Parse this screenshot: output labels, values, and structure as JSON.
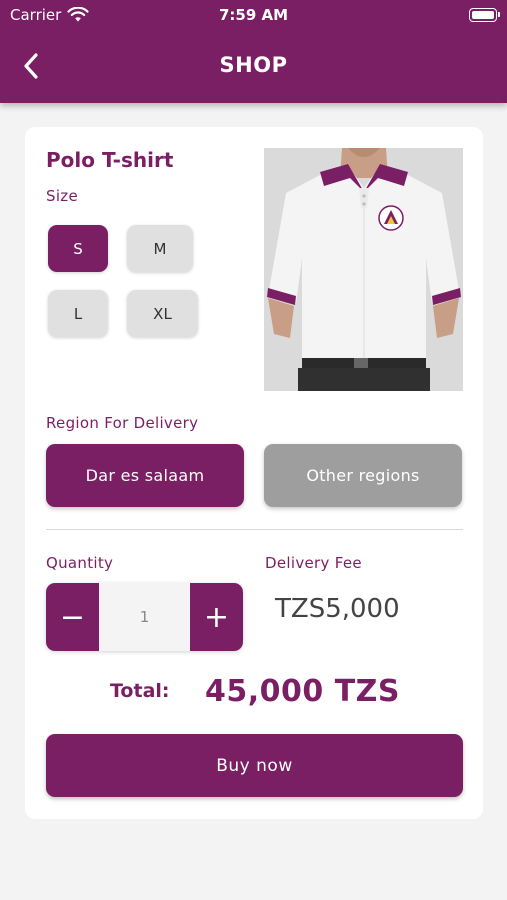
{
  "status_bar": {
    "carrier": "Carrier",
    "time": "7:59 AM"
  },
  "header": {
    "title": "SHOP",
    "back_icon": "chevron-left-icon"
  },
  "product": {
    "name": "Polo T-shirt",
    "size_label": "Size",
    "sizes": [
      "S",
      "M",
      "L",
      "XL"
    ],
    "selected_size": "S",
    "image_subject": "white polo t-shirt with purple collar"
  },
  "delivery": {
    "region_label": "Region For Delivery",
    "regions": [
      "Dar es salaam",
      "Other regions"
    ],
    "selected_region": "Dar es salaam",
    "fee_label": "Delivery Fee",
    "fee_value": "TZS5,000"
  },
  "quantity": {
    "label": "Quantity",
    "value": "1",
    "minus": "−",
    "plus": "+"
  },
  "total": {
    "label": "Total:",
    "value": "45,000 TZS"
  },
  "actions": {
    "buy_label": "Buy now"
  },
  "colors": {
    "primary": "#7b1f65",
    "inactive": "#9e9e9e",
    "chip": "#e0e0e1",
    "background": "#f3f3f4"
  }
}
